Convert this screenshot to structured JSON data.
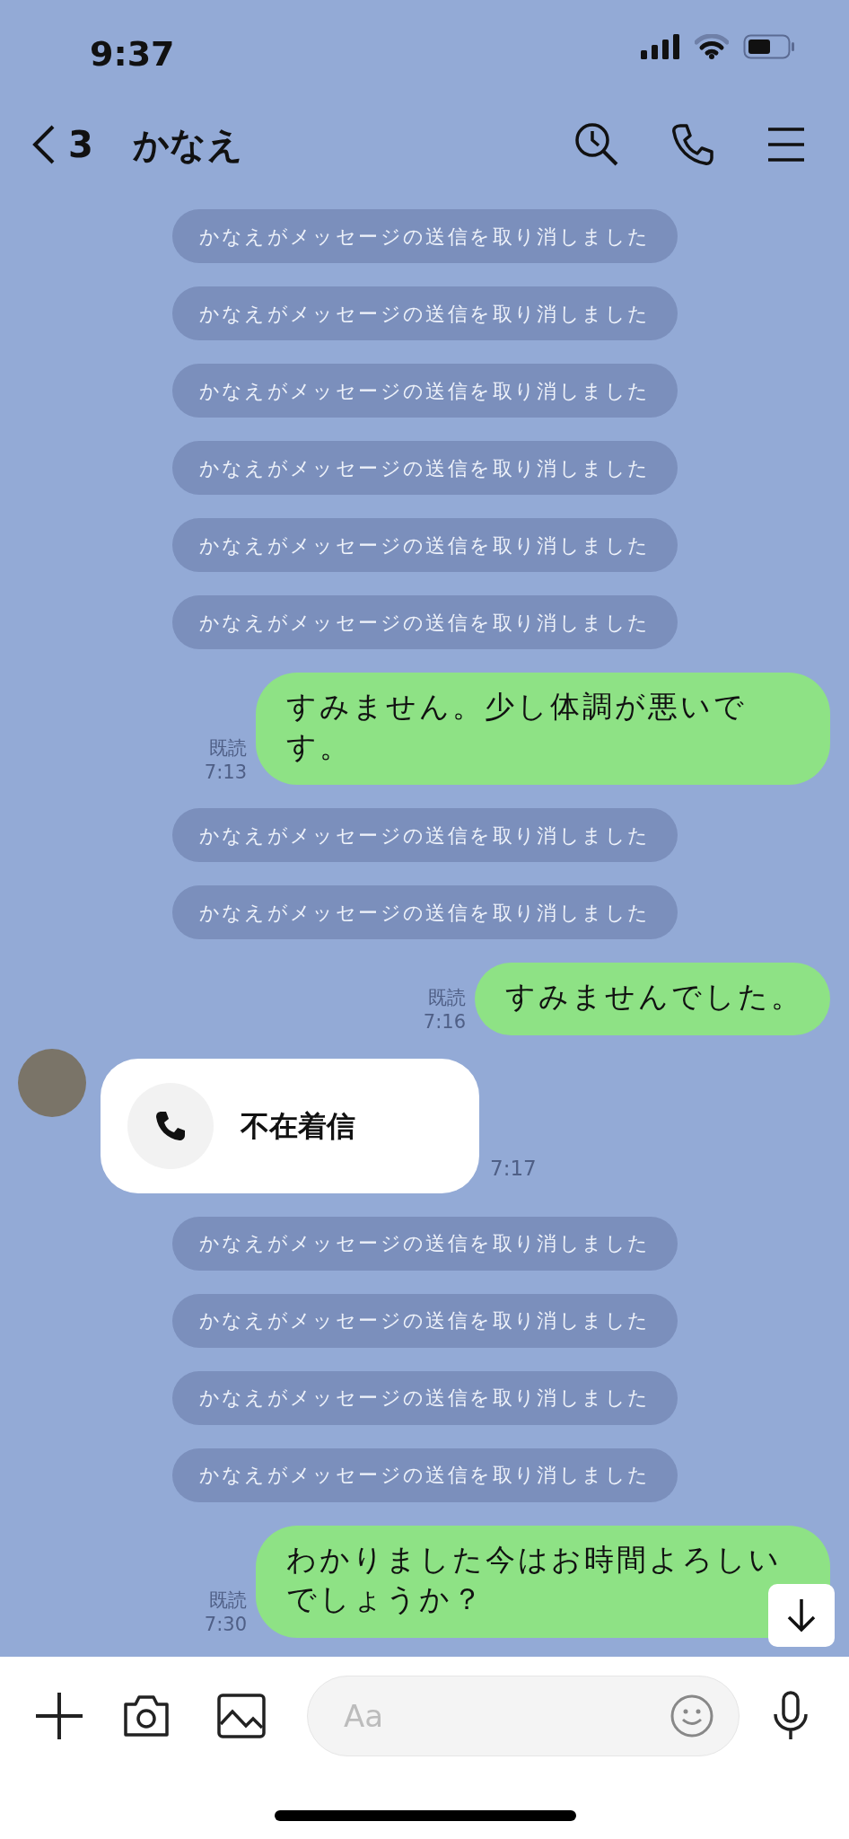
{
  "status_bar": {
    "time": "9:37"
  },
  "header": {
    "back_count": "3",
    "title": "かなえ"
  },
  "messages": [
    {
      "kind": "notice",
      "text": "かなえがメッセージの送信を取り消しました"
    },
    {
      "kind": "notice",
      "text": "かなえがメッセージの送信を取り消しました"
    },
    {
      "kind": "notice",
      "text": "かなえがメッセージの送信を取り消しました"
    },
    {
      "kind": "notice",
      "text": "かなえがメッセージの送信を取り消しました"
    },
    {
      "kind": "notice",
      "text": "かなえがメッセージの送信を取り消しました"
    },
    {
      "kind": "notice",
      "text": "かなえがメッセージの送信を取り消しました"
    },
    {
      "kind": "sent",
      "text": "すみません。少し体調が悪いです。",
      "read": "既読",
      "time": "7:13"
    },
    {
      "kind": "notice",
      "text": "かなえがメッセージの送信を取り消しました"
    },
    {
      "kind": "notice",
      "text": "かなえがメッセージの送信を取り消しました"
    },
    {
      "kind": "sent",
      "text": "すみませんでした。",
      "read": "既読",
      "time": "7:16"
    },
    {
      "kind": "missed_call",
      "text": "不在着信",
      "time": "7:17"
    },
    {
      "kind": "notice",
      "text": "かなえがメッセージの送信を取り消しました"
    },
    {
      "kind": "notice",
      "text": "かなえがメッセージの送信を取り消しました"
    },
    {
      "kind": "notice",
      "text": "かなえがメッセージの送信を取り消しました"
    },
    {
      "kind": "notice",
      "text": "かなえがメッセージの送信を取り消しました"
    },
    {
      "kind": "sent",
      "text": "わかりました今はお時間よろしいでしょうか？",
      "read": "既読",
      "time": "7:30"
    }
  ],
  "composer": {
    "placeholder": "Aa"
  }
}
